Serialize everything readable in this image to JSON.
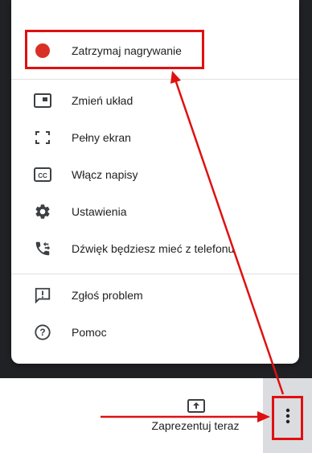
{
  "menu": {
    "record": {
      "label": "Zatrzymaj nagrywanie",
      "icon": "record-dot-icon",
      "dot_color": "#d93025"
    },
    "items": [
      {
        "label": "Zmień układ",
        "icon": "layout-icon"
      },
      {
        "label": "Pełny ekran",
        "icon": "fullscreen-icon"
      },
      {
        "label": "Włącz napisy",
        "icon": "captions-icon"
      },
      {
        "label": "Ustawienia",
        "icon": "gear-icon"
      },
      {
        "label": "Dźwięk będziesz mieć z telefonu",
        "icon": "phone-audio-icon"
      }
    ],
    "support": [
      {
        "label": "Zgłoś problem",
        "icon": "report-problem-icon"
      },
      {
        "label": "Pomoc",
        "icon": "help-icon"
      }
    ]
  },
  "bottom_bar": {
    "present_label": "Zaprezentuj teraz",
    "present_icon": "present-screen-icon",
    "more_icon": "more-vert-icon"
  },
  "annotation": {
    "color": "#e01010"
  }
}
